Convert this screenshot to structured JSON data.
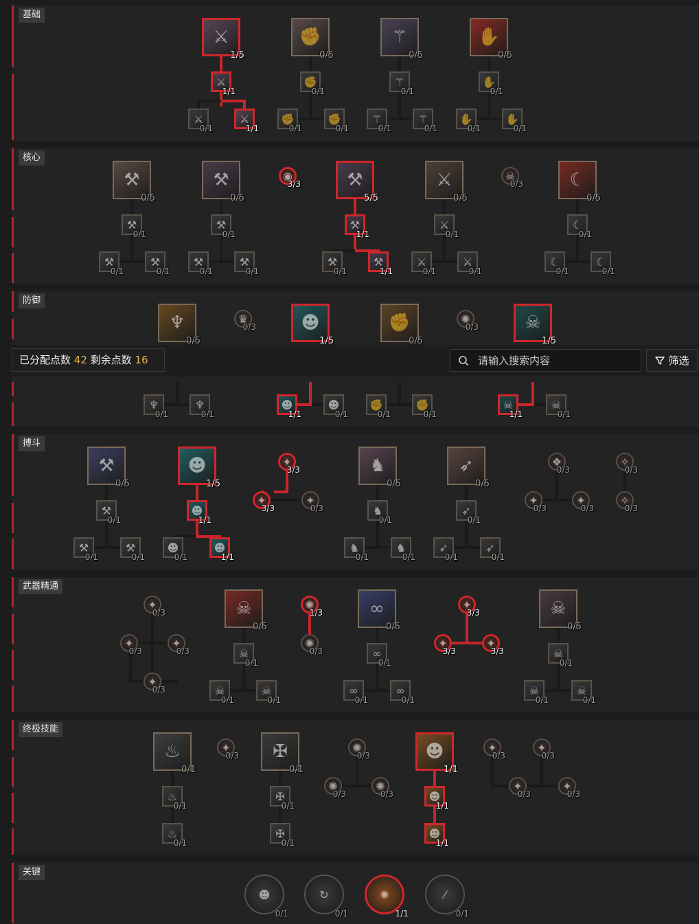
{
  "summary": {
    "allocated_label": "已分配点数",
    "allocated_value": "42",
    "remaining_label": "剩余点数",
    "remaining_value": "16"
  },
  "search": {
    "placeholder": "请输入搜索内容"
  },
  "filter": {
    "label": "筛选"
  },
  "sections": {
    "basic": "基础",
    "core": "核心",
    "defense": "防御",
    "brawl": "搏斗",
    "weapon": "武器精通",
    "ultimate": "终极技能",
    "key": "关键"
  },
  "colors": {
    "accent_red": "#d0262c",
    "points_gold": "#e2b94f"
  },
  "skills": [
    {
      "id": "b1",
      "count": "1/5",
      "icon": "shouting-warrior-icon",
      "allocated": true
    },
    {
      "id": "b1a",
      "count": "1/1",
      "icon": "shouting-warrior-icon",
      "allocated": true
    },
    {
      "id": "b1b",
      "count": "0/1",
      "icon": "shouting-warrior-icon",
      "allocated": false
    },
    {
      "id": "b1c",
      "count": "1/1",
      "icon": "shouting-warrior-icon",
      "allocated": true
    },
    {
      "id": "b2",
      "count": "0/5",
      "icon": "fist-icon",
      "allocated": false
    },
    {
      "id": "b2a",
      "count": "0/1",
      "icon": "fist-icon",
      "allocated": false
    },
    {
      "id": "b2b",
      "count": "0/1",
      "icon": "fist-icon",
      "allocated": false
    },
    {
      "id": "b2c",
      "count": "0/1",
      "icon": "fist-icon",
      "allocated": false
    },
    {
      "id": "b3",
      "count": "0/5",
      "icon": "claws-icon",
      "allocated": false
    },
    {
      "id": "b3a",
      "count": "0/1",
      "icon": "claws-icon",
      "allocated": false
    },
    {
      "id": "b3b",
      "count": "0/1",
      "icon": "claws-icon",
      "allocated": false
    },
    {
      "id": "b3c",
      "count": "0/1",
      "icon": "claws-icon",
      "allocated": false
    },
    {
      "id": "b4",
      "count": "0/5",
      "icon": "gauntlet-icon",
      "allocated": false
    },
    {
      "id": "b4a",
      "count": "0/1",
      "icon": "gauntlet-icon",
      "allocated": false
    },
    {
      "id": "b4b",
      "count": "0/1",
      "icon": "gauntlet-icon",
      "allocated": false
    },
    {
      "id": "b4c",
      "count": "0/1",
      "icon": "gauntlet-icon",
      "allocated": false
    },
    {
      "id": "c1",
      "count": "0/5",
      "icon": "whirlwind-axe-icon",
      "allocated": false
    },
    {
      "id": "c1a",
      "count": "0/1",
      "icon": "whirlwind-axe-icon",
      "allocated": false
    },
    {
      "id": "c1b",
      "count": "0/1",
      "icon": "whirlwind-axe-icon",
      "allocated": false
    },
    {
      "id": "c1c",
      "count": "0/1",
      "icon": "whirlwind-axe-icon",
      "allocated": false
    },
    {
      "id": "c2",
      "count": "0/5",
      "icon": "anvil-icon",
      "allocated": false
    },
    {
      "id": "c2a",
      "count": "0/1",
      "icon": "anvil-icon",
      "allocated": false
    },
    {
      "id": "c2b",
      "count": "0/1",
      "icon": "anvil-icon",
      "allocated": false
    },
    {
      "id": "c2c",
      "count": "0/1",
      "icon": "anvil-icon",
      "allocated": false
    },
    {
      "id": "cp1",
      "count": "3/3",
      "icon": "rune-icon",
      "allocated": true
    },
    {
      "id": "c3",
      "count": "5/5",
      "icon": "hammer-strike-icon",
      "allocated": true
    },
    {
      "id": "c3a",
      "count": "1/1",
      "icon": "hammer-strike-icon",
      "allocated": true
    },
    {
      "id": "c3b",
      "count": "0/1",
      "icon": "hammer-strike-icon",
      "allocated": false
    },
    {
      "id": "c3c",
      "count": "1/1",
      "icon": "hammer-strike-icon",
      "allocated": true
    },
    {
      "id": "c4",
      "count": "0/5",
      "icon": "crossed-axes-icon",
      "allocated": false
    },
    {
      "id": "c4a",
      "count": "0/1",
      "icon": "crossed-axes-icon",
      "allocated": false
    },
    {
      "id": "c4b",
      "count": "0/1",
      "icon": "crossed-axes-icon",
      "allocated": false
    },
    {
      "id": "c4c",
      "count": "0/1",
      "icon": "crossed-axes-icon",
      "allocated": false
    },
    {
      "id": "cp2",
      "count": "0/3",
      "icon": "skull-rune-icon",
      "allocated": false
    },
    {
      "id": "c5",
      "count": "0/5",
      "icon": "scythe-icon",
      "allocated": false
    },
    {
      "id": "c5a",
      "count": "0/1",
      "icon": "scythe-icon",
      "allocated": false
    },
    {
      "id": "c5b",
      "count": "0/1",
      "icon": "scythe-icon",
      "allocated": false
    },
    {
      "id": "c5c",
      "count": "0/1",
      "icon": "scythe-icon",
      "allocated": false
    },
    {
      "id": "d1",
      "count": "0/5",
      "icon": "golden-goblet-icon",
      "allocated": false
    },
    {
      "id": "d1a",
      "count": "0/1",
      "icon": "golden-goblet-icon",
      "allocated": false
    },
    {
      "id": "d1b",
      "count": "0/1",
      "icon": "golden-goblet-icon",
      "allocated": false
    },
    {
      "id": "dp1",
      "count": "0/3",
      "icon": "crown-rune-icon",
      "allocated": false
    },
    {
      "id": "d2",
      "count": "1/5",
      "icon": "demon-face-icon",
      "allocated": true
    },
    {
      "id": "d2a",
      "count": "1/1",
      "icon": "demon-face-icon",
      "allocated": true
    },
    {
      "id": "d2b",
      "count": "0/1",
      "icon": "demon-face-icon",
      "allocated": false
    },
    {
      "id": "d3",
      "count": "0/5",
      "icon": "fist-shield-icon",
      "allocated": false
    },
    {
      "id": "d3a",
      "count": "0/1",
      "icon": "fist-shield-icon",
      "allocated": false
    },
    {
      "id": "d3b",
      "count": "0/1",
      "icon": "fist-shield-icon",
      "allocated": false
    },
    {
      "id": "dp2",
      "count": "0/3",
      "icon": "red-rune-icon",
      "allocated": false
    },
    {
      "id": "d4",
      "count": "1/5",
      "icon": "skull-pile-icon",
      "allocated": true
    },
    {
      "id": "d4a",
      "count": "1/1",
      "icon": "skull-pile-icon",
      "allocated": true
    },
    {
      "id": "d4b",
      "count": "0/1",
      "icon": "skull-pile-icon",
      "allocated": false
    },
    {
      "id": "g1",
      "count": "0/5",
      "icon": "leaping-hammer-icon",
      "allocated": false
    },
    {
      "id": "g1a",
      "count": "0/1",
      "icon": "leaping-hammer-icon",
      "allocated": false
    },
    {
      "id": "g1b",
      "count": "0/1",
      "icon": "leaping-hammer-icon",
      "allocated": false
    },
    {
      "id": "g1c",
      "count": "0/1",
      "icon": "leaping-hammer-icon",
      "allocated": false
    },
    {
      "id": "g2",
      "count": "1/5",
      "icon": "war-cry-icon",
      "allocated": true
    },
    {
      "id": "g2a",
      "count": "1/1",
      "icon": "war-cry-icon",
      "allocated": true
    },
    {
      "id": "g2b",
      "count": "0/1",
      "icon": "war-cry-icon",
      "allocated": false
    },
    {
      "id": "g2c",
      "count": "1/1",
      "icon": "war-cry-icon",
      "allocated": true
    },
    {
      "id": "gp1",
      "count": "3/3",
      "icon": "horn-rune-icon",
      "allocated": true
    },
    {
      "id": "gp2",
      "count": "3/3",
      "icon": "horn-rune-icon",
      "allocated": true
    },
    {
      "id": "gp3",
      "count": "0/3",
      "icon": "horn-rune-icon",
      "allocated": false
    },
    {
      "id": "g3",
      "count": "0/5",
      "icon": "charging-beast-icon",
      "allocated": false
    },
    {
      "id": "g3a",
      "count": "0/1",
      "icon": "charging-beast-icon",
      "allocated": false
    },
    {
      "id": "g3b",
      "count": "0/1",
      "icon": "charging-beast-icon",
      "allocated": false
    },
    {
      "id": "g3c",
      "count": "0/1",
      "icon": "charging-beast-icon",
      "allocated": false
    },
    {
      "id": "g4",
      "count": "0/5",
      "icon": "kick-icon",
      "allocated": false
    },
    {
      "id": "g4a",
      "count": "0/1",
      "icon": "kick-icon",
      "allocated": false
    },
    {
      "id": "g4b",
      "count": "0/1",
      "icon": "kick-icon",
      "allocated": false
    },
    {
      "id": "g4c",
      "count": "0/1",
      "icon": "kick-icon",
      "allocated": false
    },
    {
      "id": "gp4",
      "count": "0/3",
      "icon": "purple-rune-icon",
      "allocated": false
    },
    {
      "id": "gp5",
      "count": "0/3",
      "icon": "claw-rune-icon",
      "allocated": false
    },
    {
      "id": "gp6",
      "count": "0/3",
      "icon": "claw-rune-icon",
      "allocated": false
    },
    {
      "id": "gp7",
      "count": "0/3",
      "icon": "wing-rune-icon",
      "allocated": false
    },
    {
      "id": "gp8",
      "count": "0/3",
      "icon": "wing-rune-icon",
      "allocated": false
    },
    {
      "id": "wp1",
      "count": "0/3",
      "icon": "mace-rune-icon",
      "allocated": false
    },
    {
      "id": "wp2",
      "count": "0/3",
      "icon": "mace-rune-icon",
      "allocated": false
    },
    {
      "id": "wp3",
      "count": "0/3",
      "icon": "mace-rune-icon",
      "allocated": false
    },
    {
      "id": "wp4",
      "count": "0/3",
      "icon": "mace-rune-icon",
      "allocated": false
    },
    {
      "id": "w1",
      "count": "0/5",
      "icon": "death-skull-icon",
      "allocated": false
    },
    {
      "id": "w1a",
      "count": "0/1",
      "icon": "death-skull-icon",
      "allocated": false
    },
    {
      "id": "w1b",
      "count": "0/1",
      "icon": "death-skull-icon",
      "allocated": false
    },
    {
      "id": "w1c",
      "count": "0/1",
      "icon": "death-skull-icon",
      "allocated": false
    },
    {
      "id": "wp5",
      "count": "1/3",
      "icon": "blood-rune-icon",
      "allocated": true
    },
    {
      "id": "wp6",
      "count": "0/3",
      "icon": "blood-rune-icon",
      "allocated": false
    },
    {
      "id": "w2",
      "count": "0/5",
      "icon": "chain-icon",
      "allocated": false
    },
    {
      "id": "w2a",
      "count": "0/1",
      "icon": "chain-icon",
      "allocated": false
    },
    {
      "id": "w2b",
      "count": "0/1",
      "icon": "chain-icon",
      "allocated": false
    },
    {
      "id": "w2c",
      "count": "0/1",
      "icon": "chain-icon",
      "allocated": false
    },
    {
      "id": "wp7",
      "count": "3/3",
      "icon": "sword-rune-icon",
      "allocated": true
    },
    {
      "id": "wp8",
      "count": "3/3",
      "icon": "sword-rune-icon",
      "allocated": true
    },
    {
      "id": "wp9",
      "count": "3/3",
      "icon": "sword-rune-icon",
      "allocated": true
    },
    {
      "id": "w3",
      "count": "0/5",
      "icon": "helmet-skull-icon",
      "allocated": false
    },
    {
      "id": "w3a",
      "count": "0/1",
      "icon": "helmet-skull-icon",
      "allocated": false
    },
    {
      "id": "w3b",
      "count": "0/1",
      "icon": "helmet-skull-icon",
      "allocated": false
    },
    {
      "id": "w3c",
      "count": "0/1",
      "icon": "helmet-skull-icon",
      "allocated": false
    },
    {
      "id": "u1",
      "count": "0/1",
      "icon": "fire-horn-icon",
      "allocated": false
    },
    {
      "id": "u1a",
      "count": "0/1",
      "icon": "fire-horn-icon",
      "allocated": false
    },
    {
      "id": "u1b",
      "count": "0/1",
      "icon": "fire-horn-icon",
      "allocated": false
    },
    {
      "id": "up1",
      "count": "0/3",
      "icon": "axe-rune-icon",
      "allocated": false
    },
    {
      "id": "u2",
      "count": "0/1",
      "icon": "iron-sword-icon",
      "allocated": false
    },
    {
      "id": "u2a",
      "count": "0/1",
      "icon": "iron-sword-icon",
      "allocated": false
    },
    {
      "id": "u2b",
      "count": "0/1",
      "icon": "iron-sword-icon",
      "allocated": false
    },
    {
      "id": "up2",
      "count": "0/3",
      "icon": "fire-rune-icon",
      "allocated": false
    },
    {
      "id": "up3",
      "count": "0/3",
      "icon": "fire-rune-icon",
      "allocated": false
    },
    {
      "id": "up4",
      "count": "0/3",
      "icon": "fire-rune-icon",
      "allocated": false
    },
    {
      "id": "u3",
      "count": "1/1",
      "icon": "berserk-face-icon",
      "allocated": true
    },
    {
      "id": "u3a",
      "count": "1/1",
      "icon": "berserk-face-icon",
      "allocated": true
    },
    {
      "id": "u3b",
      "count": "1/1",
      "icon": "berserk-face-icon",
      "allocated": true
    },
    {
      "id": "up5",
      "count": "0/3",
      "icon": "spike-rune-icon",
      "allocated": false
    },
    {
      "id": "up6",
      "count": "0/3",
      "icon": "spike-rune-icon",
      "allocated": false
    },
    {
      "id": "up7",
      "count": "0/3",
      "icon": "spike-rune-icon",
      "allocated": false
    },
    {
      "id": "up8",
      "count": "0/3",
      "icon": "spike-rune-icon",
      "allocated": false
    },
    {
      "id": "k1",
      "count": "0/1",
      "icon": "mask-icon",
      "allocated": false
    },
    {
      "id": "k2",
      "count": "0/1",
      "icon": "cycle-axe-icon",
      "allocated": false
    },
    {
      "id": "k3",
      "count": "1/1",
      "icon": "orange-glyph-icon",
      "allocated": true
    },
    {
      "id": "k4",
      "count": "0/1",
      "icon": "slash-drops-icon",
      "allocated": false
    }
  ]
}
